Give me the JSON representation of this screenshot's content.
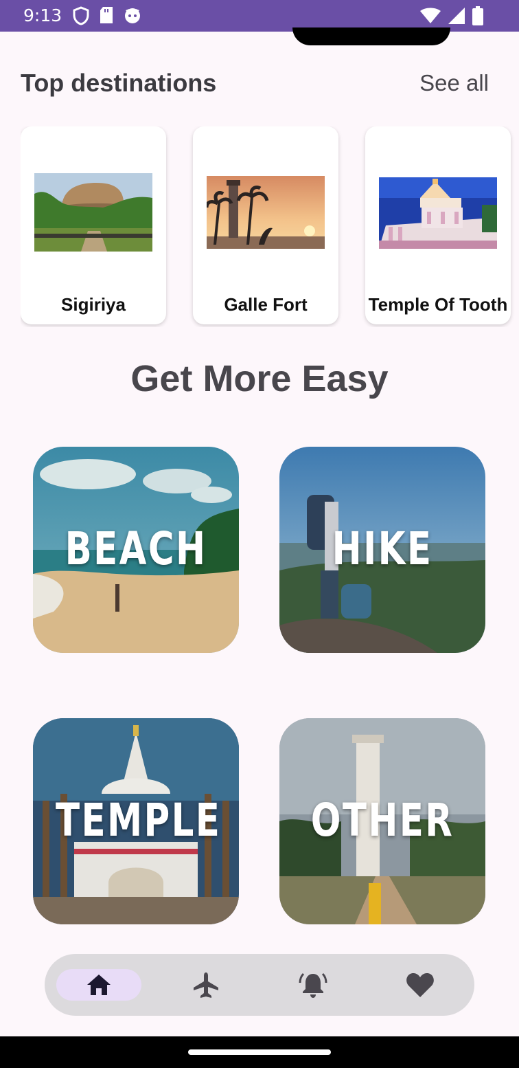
{
  "status_bar": {
    "time": "9:13"
  },
  "top_destinations": {
    "title": "Top destinations",
    "see_all": "See all",
    "items": [
      {
        "name": "Sigiriya"
      },
      {
        "name": "Galle Fort"
      },
      {
        "name": "Temple Of Tooth"
      }
    ]
  },
  "get_more": {
    "title": "Get More Easy",
    "categories": [
      {
        "label": "BEACH"
      },
      {
        "label": "HIKE"
      },
      {
        "label": "TEMPLE"
      },
      {
        "label": "OTHER"
      }
    ]
  },
  "bottom_nav": {
    "items": [
      {
        "icon": "home-icon",
        "active": true
      },
      {
        "icon": "airplane-icon",
        "active": false
      },
      {
        "icon": "bell-icon",
        "active": false
      },
      {
        "icon": "heart-icon",
        "active": false
      }
    ],
    "active_color": "#e8dcf7"
  },
  "colors": {
    "status_bar": "#6a4fa6",
    "background": "#fdf7fb",
    "nav_bar": "#dcdadd"
  }
}
